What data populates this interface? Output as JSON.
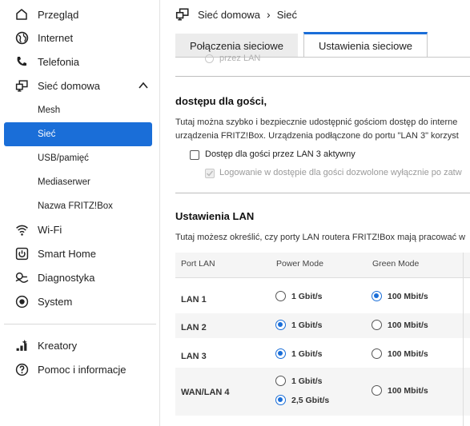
{
  "sidebar": {
    "items": [
      {
        "label": "Przegląd",
        "icon": "home-icon"
      },
      {
        "label": "Internet",
        "icon": "globe-icon"
      },
      {
        "label": "Telefonia",
        "icon": "phone-icon"
      },
      {
        "label": "Sieć domowa",
        "icon": "network-icon"
      }
    ],
    "subitems": [
      {
        "label": "Mesh"
      },
      {
        "label": "Sieć",
        "active": true
      },
      {
        "label": "USB/pamięć"
      },
      {
        "label": "Mediaserwer"
      },
      {
        "label": "Nazwa FRITZ!Box"
      }
    ],
    "items2": [
      {
        "label": "Wi-Fi",
        "icon": "wifi-icon"
      },
      {
        "label": "Smart Home",
        "icon": "smart-home-icon"
      },
      {
        "label": "Diagnostyka",
        "icon": "diagnostics-icon"
      },
      {
        "label": "System",
        "icon": "system-icon"
      }
    ],
    "items3": [
      {
        "label": "Kreatory",
        "icon": "wizard-icon"
      },
      {
        "label": "Pomoc i informacje",
        "icon": "help-icon"
      }
    ]
  },
  "breadcrumb": {
    "parent": "Sieć domowa",
    "current": "Sieć"
  },
  "tabs": [
    {
      "label": "Połączenia sieciowe",
      "active": false
    },
    {
      "label": "Ustawienia sieciowe",
      "active": true
    }
  ],
  "ghost_label": "przez LAN",
  "guest": {
    "title": "dostępu dla gości,",
    "line1": "Tutaj można szybko i bezpiecznie udostępnić gościom dostęp do interne",
    "line2": "urządzenia FRITZ!Box. Urządzenia podłączone do portu \"LAN 3\" korzyst",
    "checkbox1": "Dostęp dla gości przez LAN 3 aktywny",
    "checkbox2": "Logowanie w dostępie dla gości dozwolone wyłącznie po zatw"
  },
  "lan": {
    "title": "Ustawienia LAN",
    "desc": "Tutaj możesz określić, czy porty LAN routera FRITZ!Box mają pracować w",
    "headers": {
      "port": "Port LAN",
      "power": "Power Mode",
      "green": "Green Mode"
    },
    "rows": [
      {
        "port": "LAN 1",
        "power": "1 Gbit/s",
        "power_selected": false,
        "green": "100 Mbit/s",
        "green_selected": true
      },
      {
        "port": "LAN 2",
        "power": "1 Gbit/s",
        "power_selected": true,
        "green": "100 Mbit/s",
        "green_selected": false
      },
      {
        "port": "LAN 3",
        "power": "1 Gbit/s",
        "power_selected": true,
        "green": "100 Mbit/s",
        "green_selected": false
      },
      {
        "port": "WAN/LAN 4",
        "power": "1 Gbit/s",
        "power_selected": false,
        "power2": "2,5 Gbit/s",
        "power2_selected": true,
        "green": "100 Mbit/s",
        "green_selected": false
      }
    ]
  },
  "colors": {
    "accent": "#1a6ed8"
  }
}
